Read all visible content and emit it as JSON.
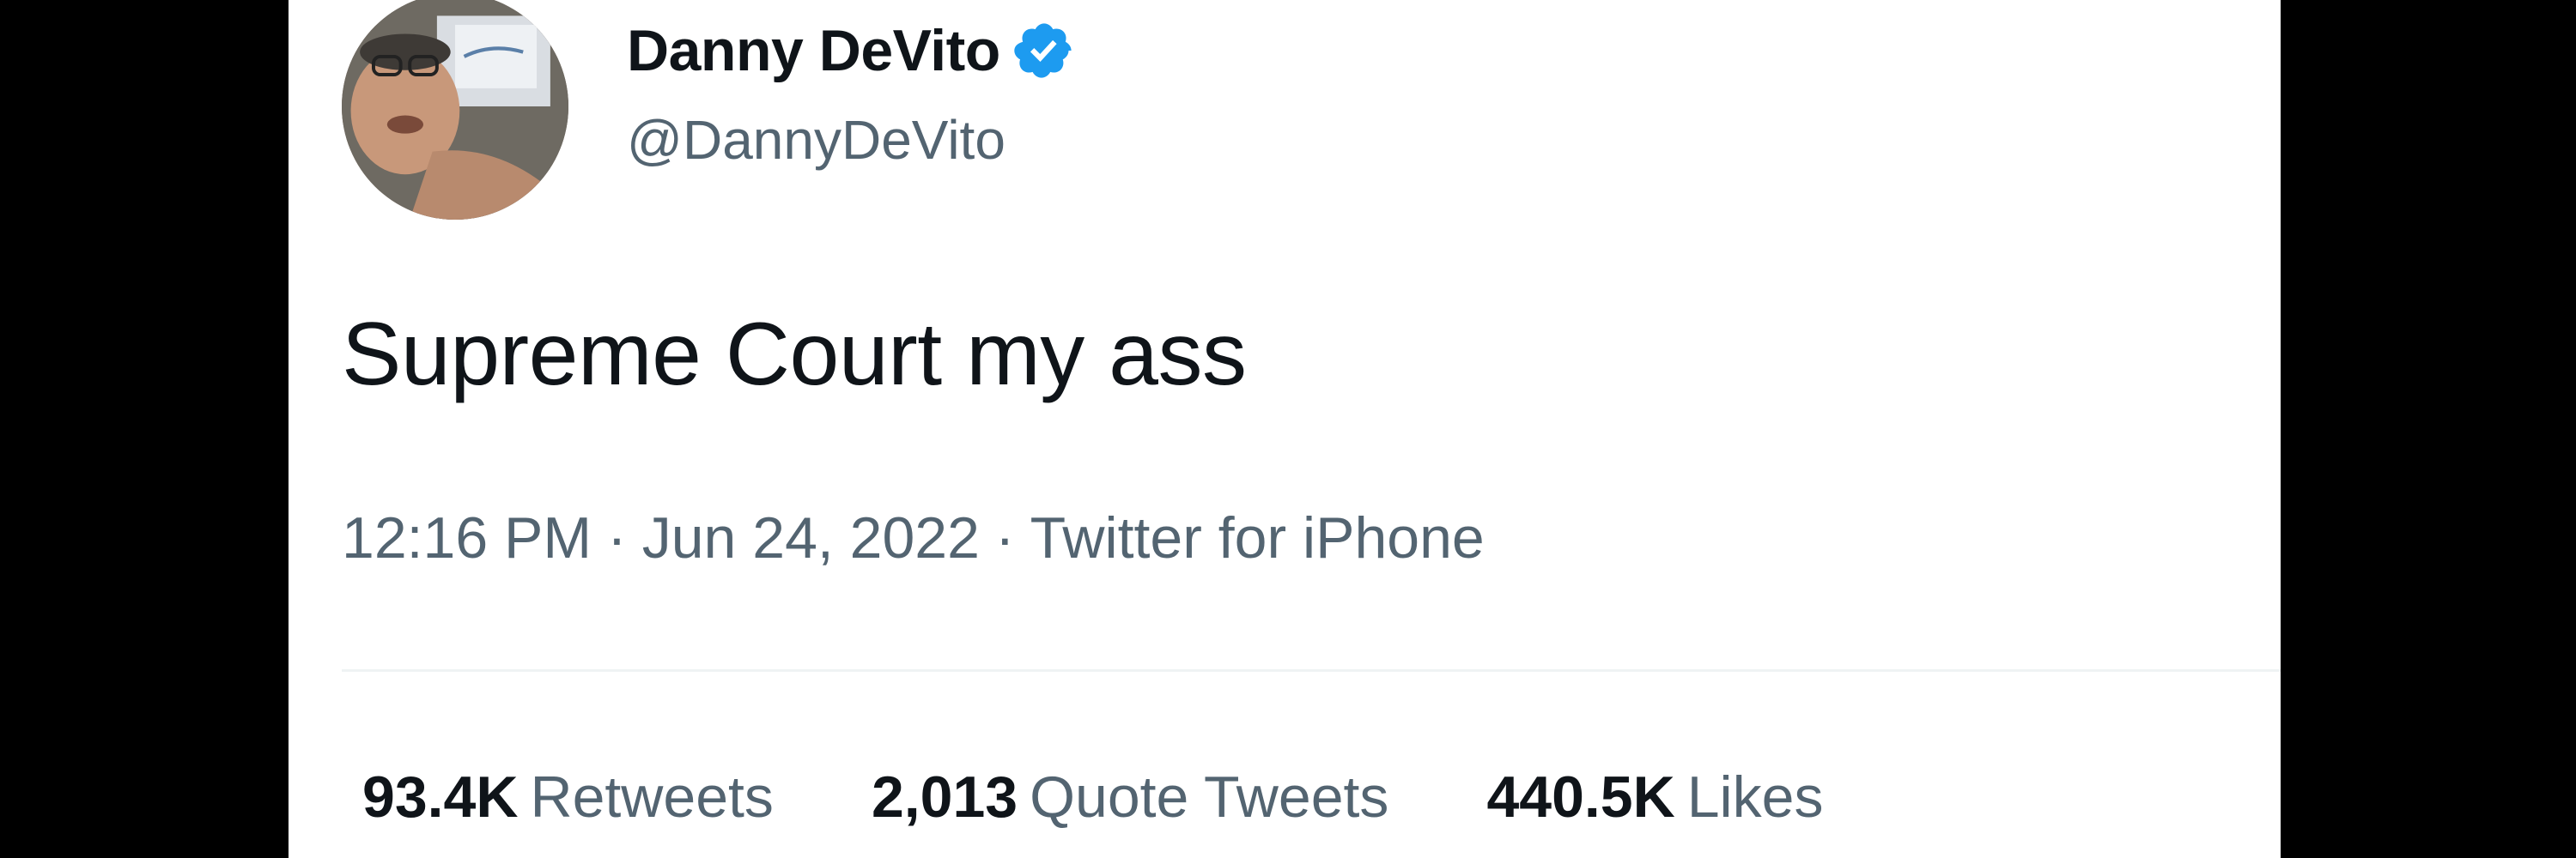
{
  "author": {
    "display_name": "Danny DeVito",
    "handle": "@DannyDeVito",
    "verified": true
  },
  "tweet": {
    "text": "Supreme Court my ass",
    "time": "12:16 PM",
    "date": "Jun 24, 2022",
    "source": "Twitter for iPhone",
    "separator": "·"
  },
  "stats": [
    {
      "count": "93.4K",
      "label": "Retweets"
    },
    {
      "count": "2,013",
      "label": "Quote Tweets"
    },
    {
      "count": "440.5K",
      "label": "Likes"
    }
  ],
  "colors": {
    "verified_badge": "#1d9bf0",
    "primary_text": "#0f1419",
    "secondary_text": "#536471",
    "background_outer": "#000000",
    "card": "#ffffff"
  }
}
